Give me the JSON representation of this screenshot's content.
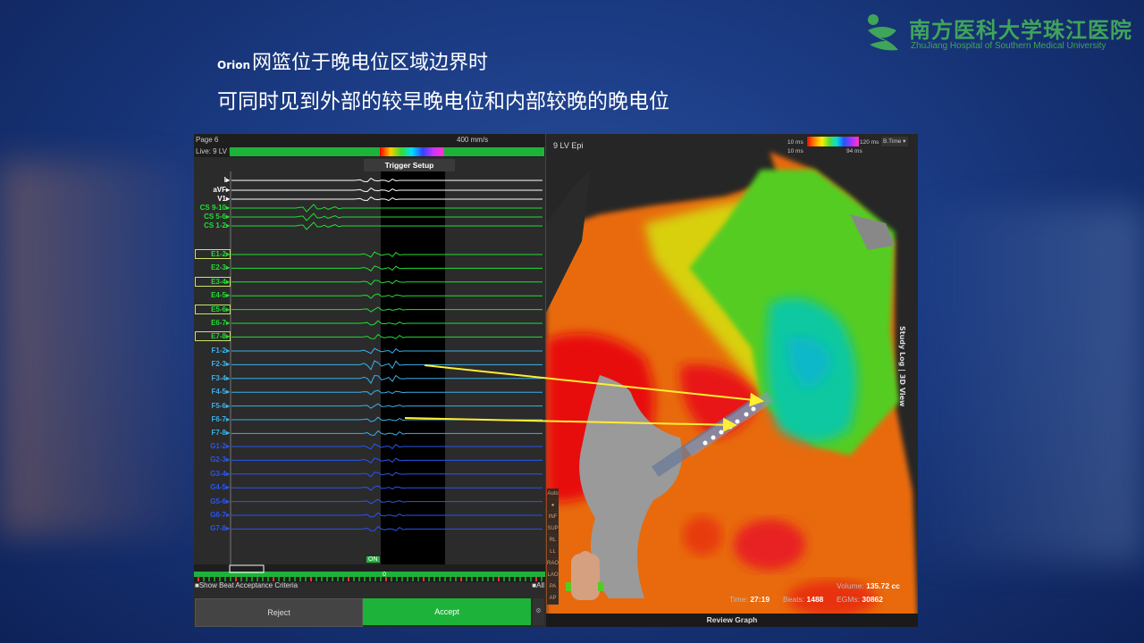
{
  "slide": {
    "line1_prefix": "Orion",
    "line1": "网篮位于晚电位区域边界时",
    "line2": "可同时见到外部的较早晚电位和内部较晚的晚电位"
  },
  "logo": {
    "cn": "南方医科大学珠江医院",
    "en": "ZhuJiang Hospital of Southern Medical University"
  },
  "ep": {
    "page": "Page 6",
    "speed": "400 mm/s",
    "live": "Live: 9 LV Epi",
    "trigger_setup": "Trigger Setup",
    "channels_ecg": [
      {
        "name": "I",
        "color": "#ffffff"
      },
      {
        "name": "aVF",
        "color": "#ffffff"
      },
      {
        "name": "V1",
        "color": "#ffffff"
      },
      {
        "name": "CS 9-10",
        "color": "#22dd33"
      },
      {
        "name": "CS 5-6",
        "color": "#22dd33"
      },
      {
        "name": "CS 1-2",
        "color": "#22dd33"
      }
    ],
    "channels_e": [
      "E1-2",
      "E2-3",
      "E3-4",
      "E4-5",
      "E5-6",
      "E6-7",
      "E7-8"
    ],
    "channels_f": [
      "F1-2",
      "F2-3",
      "F3-4",
      "F4-5",
      "F5-6",
      "F6-7",
      "F7-8"
    ],
    "channels_g": [
      "G1-2",
      "G2-3",
      "G3-4",
      "G4-5",
      "G5-6",
      "G6-7",
      "G7-8"
    ],
    "marker": "ON",
    "show_beat": "Show Beat Acceptance Criteria",
    "all": "All",
    "zero": "0",
    "reject": "Reject",
    "accept": "Accept"
  },
  "map": {
    "title": "9 LV Epi",
    "legend_min_top": "10 ms",
    "legend_max_top": "120 ms",
    "legend_min_bot": "10 ms",
    "legend_max_bot": "94 ms",
    "legend_dropdown": "B.Time",
    "side_tab": "Study Log | 3D View",
    "time_label": "Time:",
    "time_value": "27:19",
    "beats_label": "Beats:",
    "beats_value": "1488",
    "volume_label": "Volume:",
    "volume_value": "135.72 cc",
    "egms_label": "EGMs:",
    "egms_value": "30862",
    "review_graph": "Review Graph",
    "tools": [
      "Auto",
      "●",
      "INF",
      "SUP",
      "RL",
      "LL",
      "RAO",
      "LAO",
      "PA",
      "AP"
    ]
  },
  "colors": {
    "accent_green": "#1db33a",
    "arrow_yellow": "#ffee33"
  }
}
